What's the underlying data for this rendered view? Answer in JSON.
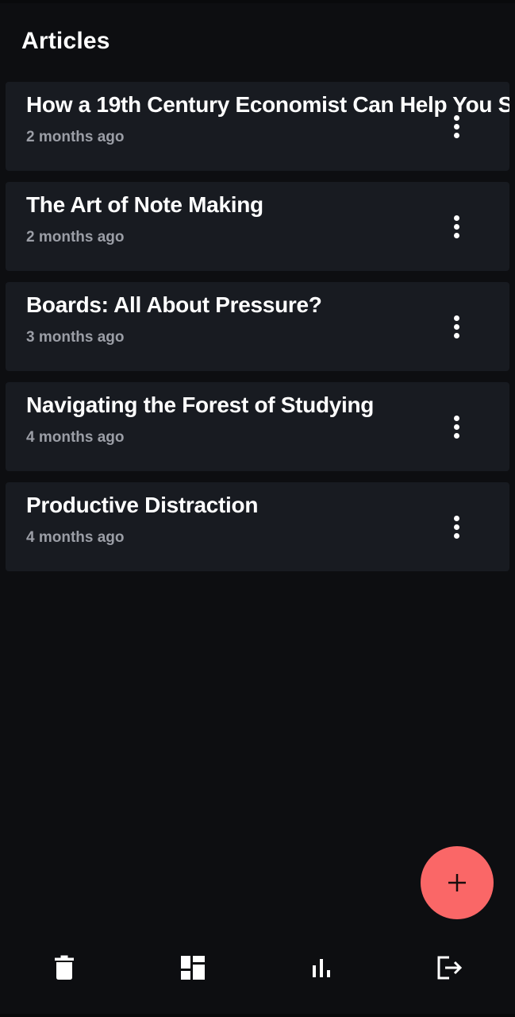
{
  "header": {
    "title": "Articles"
  },
  "articles": [
    {
      "title": "How a 19th Century Economist Can Help You S",
      "age": "2 months ago",
      "menu_icon": "more-vert-icon"
    },
    {
      "title": "The Art of Note Making",
      "age": "2 months ago",
      "menu_icon": "more-vert-icon"
    },
    {
      "title": "Boards: All About Pressure?",
      "age": "3 months ago",
      "menu_icon": "more-vert-icon"
    },
    {
      "title": "Navigating the Forest of Studying",
      "age": "4 months ago",
      "menu_icon": "more-vert-icon"
    },
    {
      "title": "Productive Distraction",
      "age": "4 months ago",
      "menu_icon": "more-vert-icon"
    }
  ],
  "fab": {
    "icon": "plus-icon",
    "color": "#fa6767"
  },
  "bottom_nav": [
    {
      "icon": "trash-icon"
    },
    {
      "icon": "dashboard-icon"
    },
    {
      "icon": "bar-chart-icon"
    },
    {
      "icon": "logout-icon"
    }
  ],
  "colors": {
    "background": "#0d0e11",
    "card": "#181b21",
    "meta_text": "#9b9ea6",
    "accent": "#fa6767"
  }
}
